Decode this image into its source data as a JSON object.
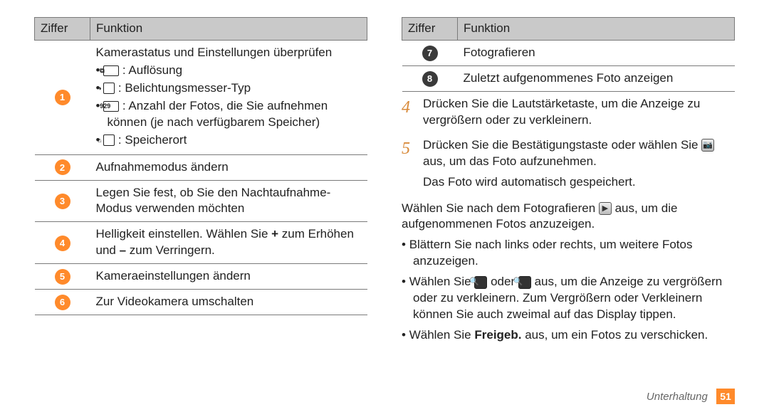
{
  "labels": {
    "ziffer": "Ziffer",
    "funktion": "Funktion"
  },
  "leftTable": {
    "rows": [
      {
        "num": "1",
        "desc_intro": "Kamerastatus und Einstellungen überprüfen",
        "items": [
          {
            "icon": "resolution-icon",
            "glyph": "⧉",
            "text": " : Auflösung"
          },
          {
            "icon": "metering-icon",
            "glyph": "◑",
            "text": " : Belichtungsmesser-Typ"
          },
          {
            "icon": "counter-icon",
            "glyph": "929",
            "text": " : Anzahl der Fotos, die Sie aufnehmen können (je nach verfügbarem Speicher)"
          },
          {
            "icon": "storage-icon",
            "glyph": "⌂",
            "text": " : Speicherort"
          }
        ]
      },
      {
        "num": "2",
        "desc": "Aufnahmemodus ändern"
      },
      {
        "num": "3",
        "desc": "Legen Sie fest, ob Sie den Nachtaufnahme-Modus verwenden möchten"
      },
      {
        "num": "4",
        "desc_pre": "Helligkeit einstellen. Wählen Sie ",
        "bold1": "+",
        "desc_mid": " zum Erhöhen und ",
        "bold2": "–",
        "desc_post": " zum Verringern."
      },
      {
        "num": "5",
        "desc": "Kameraeinstellungen ändern"
      },
      {
        "num": "6",
        "desc": "Zur Videokamera umschalten"
      }
    ]
  },
  "rightTable": {
    "rows": [
      {
        "num": "7",
        "desc": "Fotografieren"
      },
      {
        "num": "8",
        "desc": "Zuletzt aufgenommenes Foto anzeigen"
      }
    ]
  },
  "steps": {
    "s4": {
      "num": "4",
      "text": "Drücken Sie die Lautstärketaste, um die Anzeige zu vergrößern oder zu verkleinern."
    },
    "s5": {
      "num": "5",
      "line1_pre": "Drücken Sie die Bestätigungstaste oder wählen Sie ",
      "line1_post": " aus, um das Foto aufzunehmen.",
      "line2": "Das Foto wird automatisch gespeichert."
    }
  },
  "body": {
    "intro_pre": "Wählen Sie nach dem Fotografieren ",
    "intro_post": " aus, um die aufgenommenen Fotos anzuzeigen.",
    "b1": "Blättern Sie nach links oder rechts, um weitere Fotos anzuzeigen.",
    "b2_pre": "Wählen Sie ",
    "b2_mid": " oder ",
    "b2_post": " aus, um die Anzeige zu vergrößern oder zu verkleinern. Zum Vergrößern oder Verkleinern können Sie auch zweimal auf das Display tippen.",
    "b3_pre": "Wählen Sie ",
    "b3_bold": "Freigeb.",
    "b3_post": " aus, um ein Fotos zu verschicken."
  },
  "icons": {
    "camera": "📷",
    "play": "▶",
    "zoom_in": "🔍",
    "zoom_out": "🔍"
  },
  "footer": {
    "section": "Unterhaltung",
    "page": "51"
  }
}
